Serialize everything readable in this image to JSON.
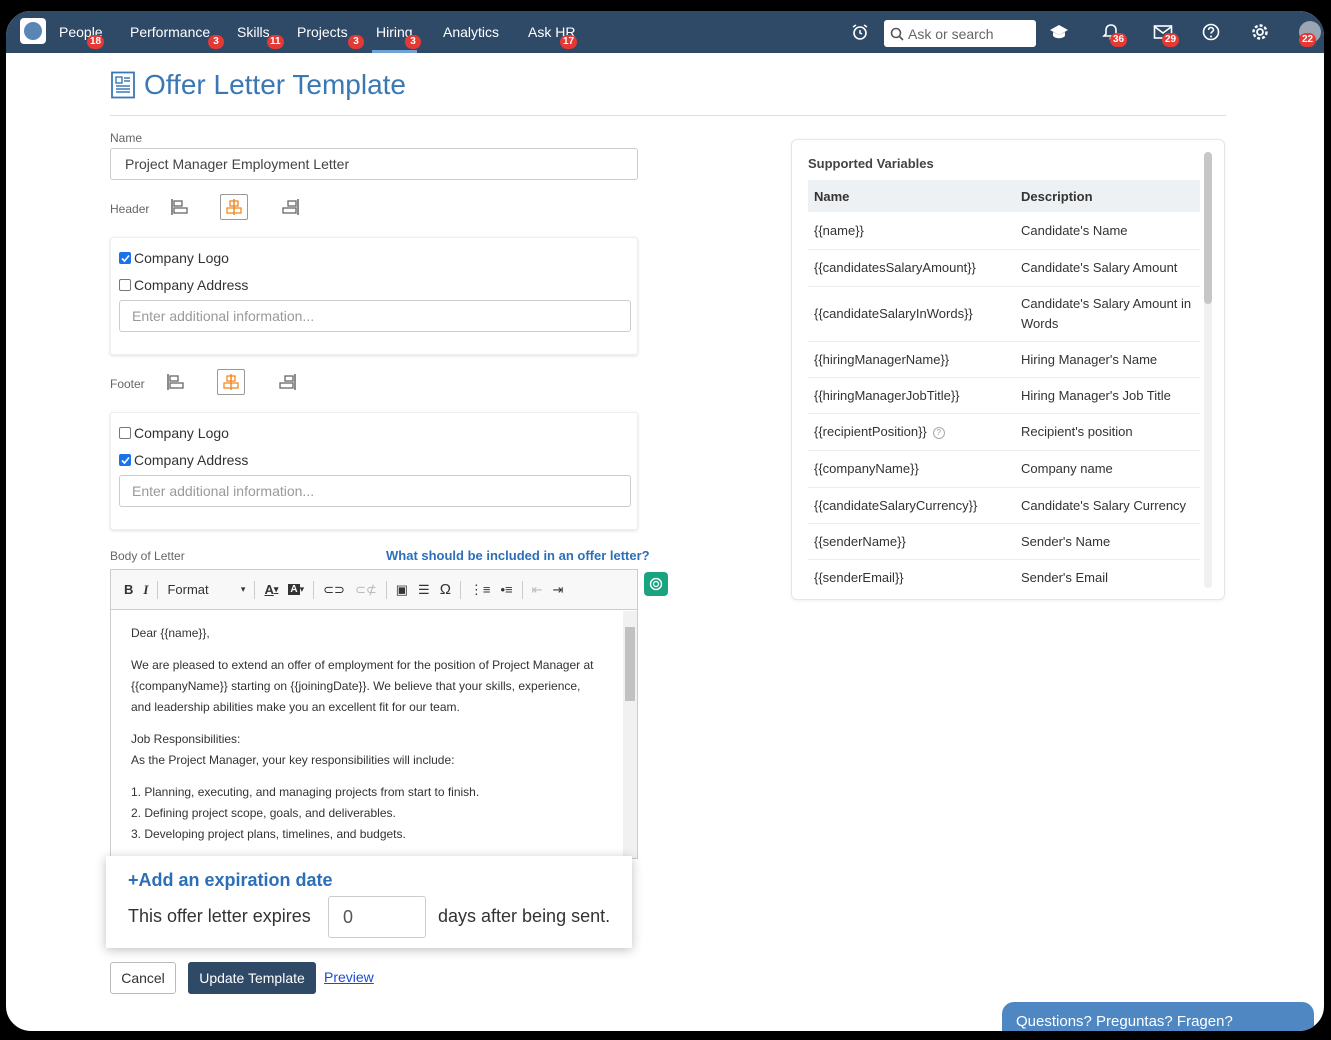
{
  "nav": {
    "items": [
      {
        "label": "People",
        "badge": "18"
      },
      {
        "label": "Performance",
        "badge": "3"
      },
      {
        "label": "Skills",
        "badge": "11"
      },
      {
        "label": "Projects",
        "badge": "3"
      },
      {
        "label": "Hiring",
        "badge": "3"
      },
      {
        "label": "Analytics",
        "badge": ""
      },
      {
        "label": "Ask HR",
        "badge": "17"
      }
    ],
    "search_placeholder": "Ask or search",
    "notifications_badge": "36",
    "messages_badge": "29",
    "avatar_badge": "22",
    "active_color": "#2f4a66"
  },
  "page": {
    "title": "Offer Letter Template",
    "name_label": "Name",
    "name_value": "Project Manager Employment Letter",
    "header_label": "Header",
    "footer_label": "Footer"
  },
  "header_box": {
    "company_logo": {
      "label": "Company Logo",
      "checked": true
    },
    "company_address": {
      "label": "Company Address",
      "checked": false
    },
    "placeholder": "Enter additional information..."
  },
  "footer_box": {
    "company_logo": {
      "label": "Company Logo",
      "checked": false
    },
    "company_address": {
      "label": "Company Address",
      "checked": true
    },
    "placeholder": "Enter additional information..."
  },
  "body": {
    "label": "Body of Letter",
    "help_link": "What should be included in an offer letter?",
    "toolbar_format": "Format",
    "paragraphs": [
      "Dear {{name}},",
      "We are pleased to extend an offer of employment for the position of Project Manager at {{companyName}} starting on {{joiningDate}}. We believe that your skills, experience, and leadership abilities make you an excellent fit for our team.",
      "Job Responsibilities:",
      "As the Project Manager, your key responsibilities will include:",
      "1. Planning, executing, and managing projects from start to finish.",
      "2. Defining project scope, goals, and deliverables.",
      "3. Developing project plans, timelines, and budgets."
    ]
  },
  "expiration": {
    "link": "+Add an expiration date",
    "prefix": "This offer letter expires",
    "days_value": "0",
    "suffix": "days after being sent."
  },
  "actions": {
    "cancel": "Cancel",
    "update": "Update Template",
    "preview": "Preview"
  },
  "variables": {
    "title": "Supported Variables",
    "headers": [
      "Name",
      "Description"
    ],
    "rows": [
      {
        "name": "{{name}}",
        "desc": "Candidate's Name"
      },
      {
        "name": "{{candidatesSalaryAmount}}",
        "desc": "Candidate's Salary Amount"
      },
      {
        "name": "{{candidateSalaryInWords}}",
        "desc": "Candidate's Salary Amount in Words"
      },
      {
        "name": "{{hiringManagerName}}",
        "desc": "Hiring Manager's Name"
      },
      {
        "name": "{{hiringManagerJobTitle}}",
        "desc": "Hiring Manager's Job Title"
      },
      {
        "name": "{{recipientPosition}}",
        "desc": "Recipient's position"
      },
      {
        "name": "{{companyName}}",
        "desc": "Company name"
      },
      {
        "name": "{{candidateSalaryCurrency}}",
        "desc": "Candidate's Salary Currency"
      },
      {
        "name": "{{senderName}}",
        "desc": "Sender's Name"
      },
      {
        "name": "{{senderEmail}}",
        "desc": "Sender's Email"
      }
    ]
  },
  "help_widget": "Questions? Preguntas? Fragen?"
}
